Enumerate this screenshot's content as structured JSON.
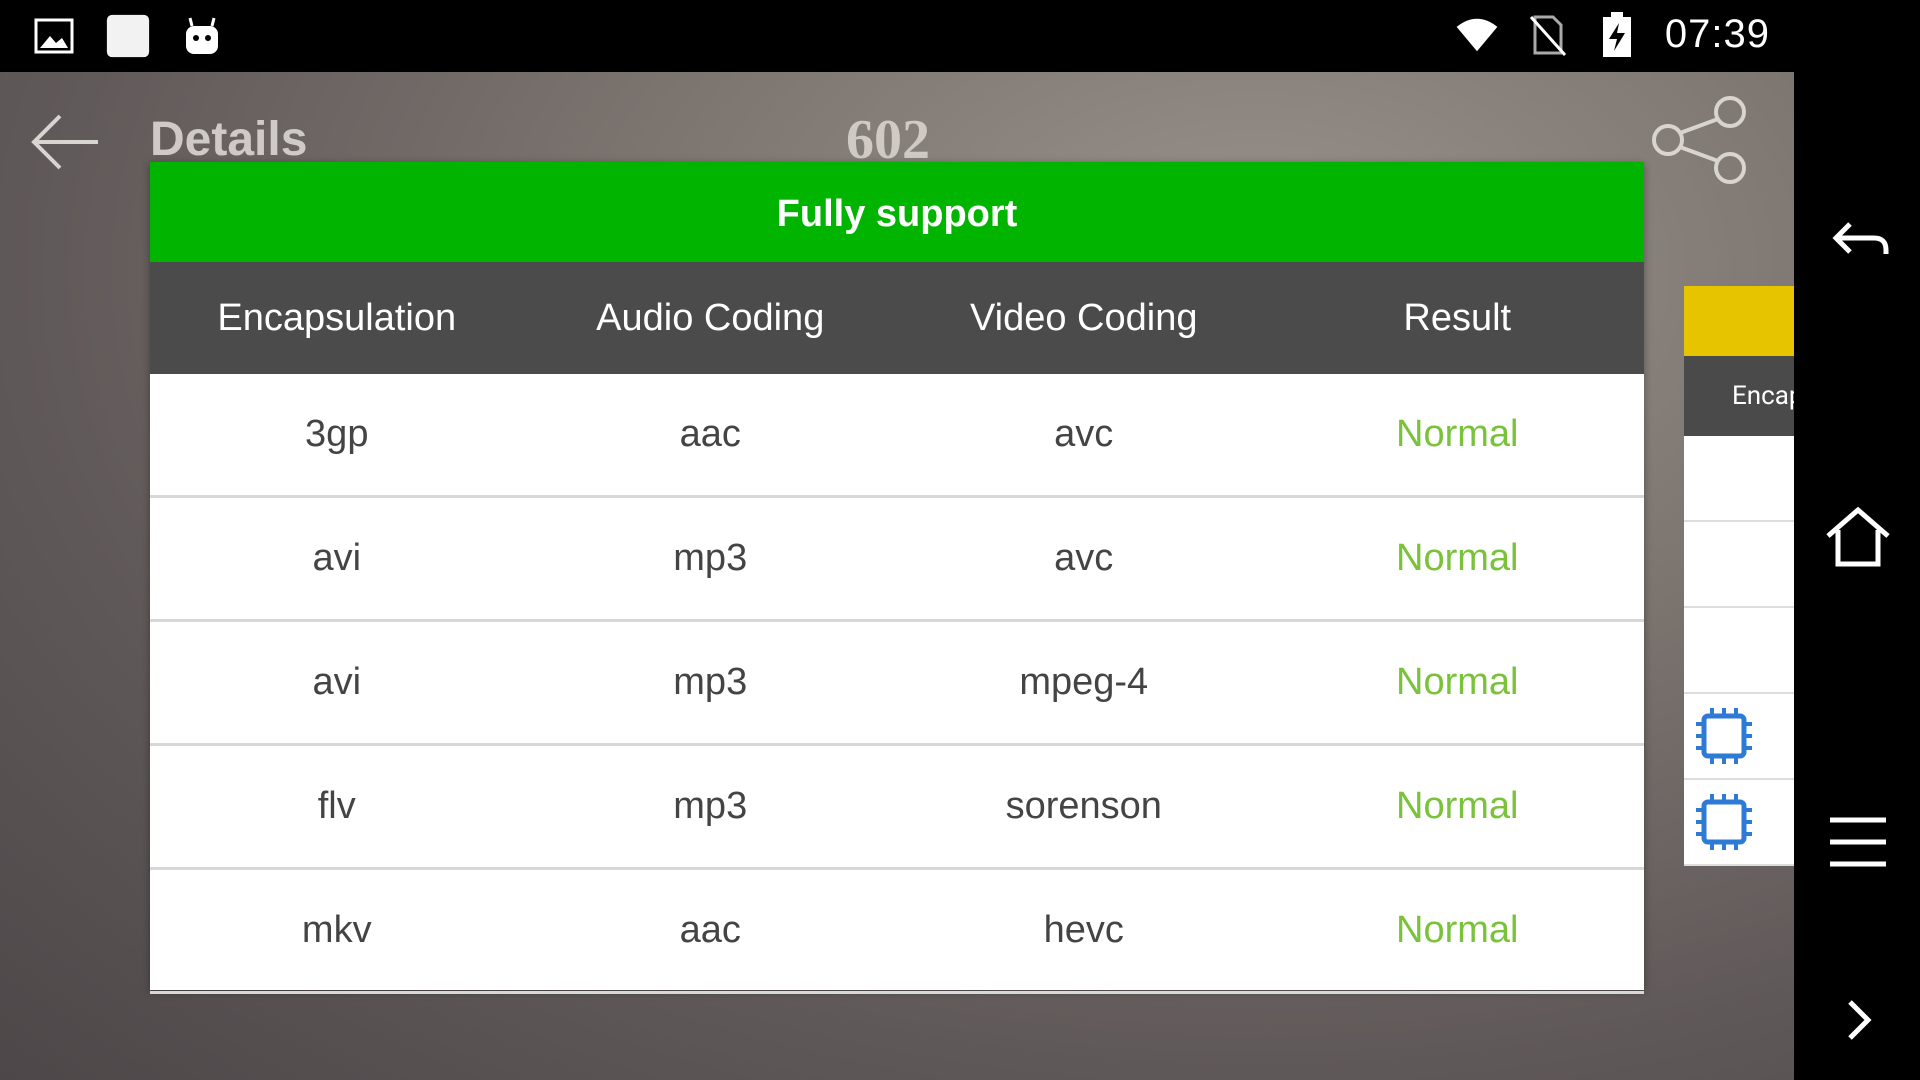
{
  "status_bar": {
    "time": "07:39",
    "icons": [
      "gallery-icon",
      "app-icon",
      "android-icon",
      "wifi-icon",
      "no-sim-icon",
      "battery-charging-icon"
    ]
  },
  "toolbar": {
    "title": "Details",
    "subtitle": "602",
    "icons": [
      "back-arrow-icon",
      "share-icon"
    ]
  },
  "dialog": {
    "header": "Fully support",
    "columns": [
      "Encapsulation",
      "Audio Coding",
      "Video Coding",
      "Result"
    ],
    "rows": [
      {
        "encapsulation": "3gp",
        "audio": "aac",
        "video": "avc",
        "result": "Normal"
      },
      {
        "encapsulation": "avi",
        "audio": "mp3",
        "video": "avc",
        "result": "Normal"
      },
      {
        "encapsulation": "avi",
        "audio": "mp3",
        "video": "mpeg-4",
        "result": "Normal"
      },
      {
        "encapsulation": "flv",
        "audio": "mp3",
        "video": "sorenson",
        "result": "Normal"
      },
      {
        "encapsulation": "mkv",
        "audio": "aac",
        "video": "hevc",
        "result": "Normal"
      }
    ]
  },
  "side_panel": {
    "header_partial": "Encap",
    "accent_color": "#e6c400",
    "icons": [
      "chip-icon",
      "chip-icon"
    ]
  },
  "colors": {
    "header_green": "#00b400",
    "result_green": "#79c23a",
    "column_header_bg": "#4b4b4b"
  },
  "nav_bar": {
    "icons": [
      "back-icon",
      "home-icon",
      "menu-icon",
      "chevron-right-icon"
    ]
  }
}
